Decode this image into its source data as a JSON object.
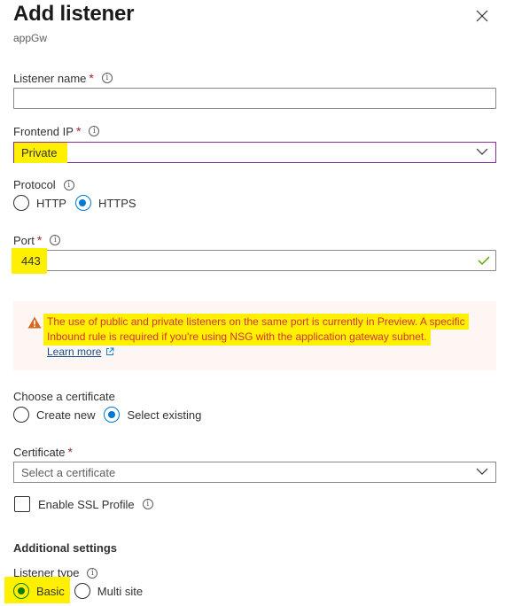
{
  "header": {
    "title": "Add listener",
    "subtitle": "appGw",
    "close_icon": "close-icon"
  },
  "listener_name": {
    "label": "Listener name",
    "required": "*",
    "value": "",
    "info_icon": "info-icon"
  },
  "frontend_ip": {
    "label": "Frontend IP",
    "required": "*",
    "selected": "Private",
    "info_icon": "info-icon"
  },
  "protocol": {
    "label": "Protocol",
    "options": [
      {
        "label": "HTTP",
        "checked": false
      },
      {
        "label": "HTTPS",
        "checked": true
      }
    ]
  },
  "port": {
    "label": "Port",
    "required": "*",
    "value": "443",
    "valid": true
  },
  "warning": {
    "icon": "warning-icon",
    "line1": "The use of public and private listeners on the same port is currently in Preview. A specific",
    "line2": "Inbound rule is required if you're using NSG with the application gateway subnet.",
    "link": "Learn more",
    "link_icon": "external-link-icon"
  },
  "certificate_choice": {
    "label": "Choose a certificate",
    "options": [
      {
        "label": "Create new",
        "checked": false
      },
      {
        "label": "Select existing",
        "checked": true
      }
    ]
  },
  "certificate": {
    "label": "Certificate",
    "required": "*",
    "placeholder": "Select a certificate"
  },
  "ssl_profile": {
    "label": "Enable SSL Profile",
    "checked": false
  },
  "additional_settings": {
    "heading": "Additional settings",
    "listener_type": {
      "label": "Listener type",
      "options": [
        {
          "label": "Basic",
          "checked": true
        },
        {
          "label": "Multi site",
          "checked": false
        }
      ]
    }
  },
  "colors": {
    "focus_border": "#8a2da5",
    "highlight": "#fff000",
    "radio_checked": "#0078d4",
    "warning_text": "#d13438",
    "warning_bg": "#fdf6f3",
    "valid_check": "#57a300"
  }
}
